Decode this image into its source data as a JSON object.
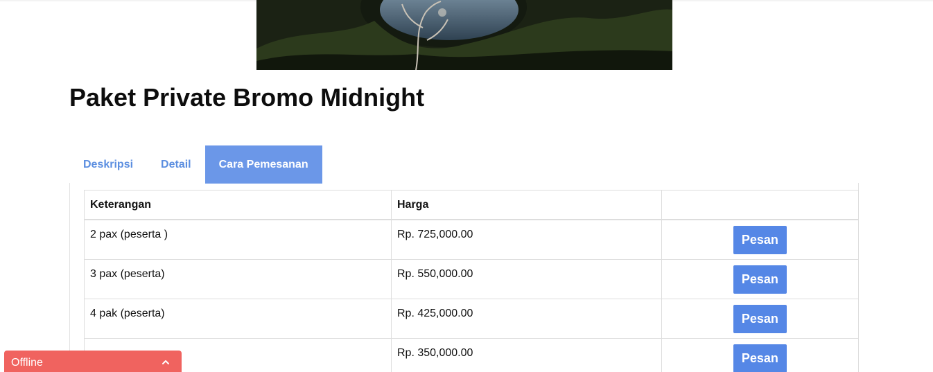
{
  "page": {
    "title": "Paket Private Bromo Midnight"
  },
  "tabs": [
    {
      "label": "Deskripsi",
      "active": false
    },
    {
      "label": "Detail",
      "active": false
    },
    {
      "label": "Cara Pemesanan",
      "active": true
    }
  ],
  "table": {
    "headers": [
      "Keterangan",
      "Harga",
      ""
    ],
    "rows": [
      {
        "keterangan": "2 pax (peserta )",
        "harga": "Rp. 725,000.00",
        "button": "Pesan"
      },
      {
        "keterangan": "3 pax (peserta)",
        "harga": "Rp. 550,000.00",
        "button": "Pesan"
      },
      {
        "keterangan": "4 pak (peserta)",
        "harga": "Rp. 425,000.00",
        "button": "Pesan"
      },
      {
        "keterangan": "",
        "harga": "Rp. 350,000.00",
        "button": "Pesan"
      }
    ]
  },
  "chat": {
    "status": "Offline",
    "icon": "chevron-up-icon"
  },
  "colors": {
    "tab_active_bg": "#6b97e8",
    "tab_text": "#5b8ee0",
    "button_bg": "#5587e6",
    "chat_bg": "#f0635f"
  }
}
